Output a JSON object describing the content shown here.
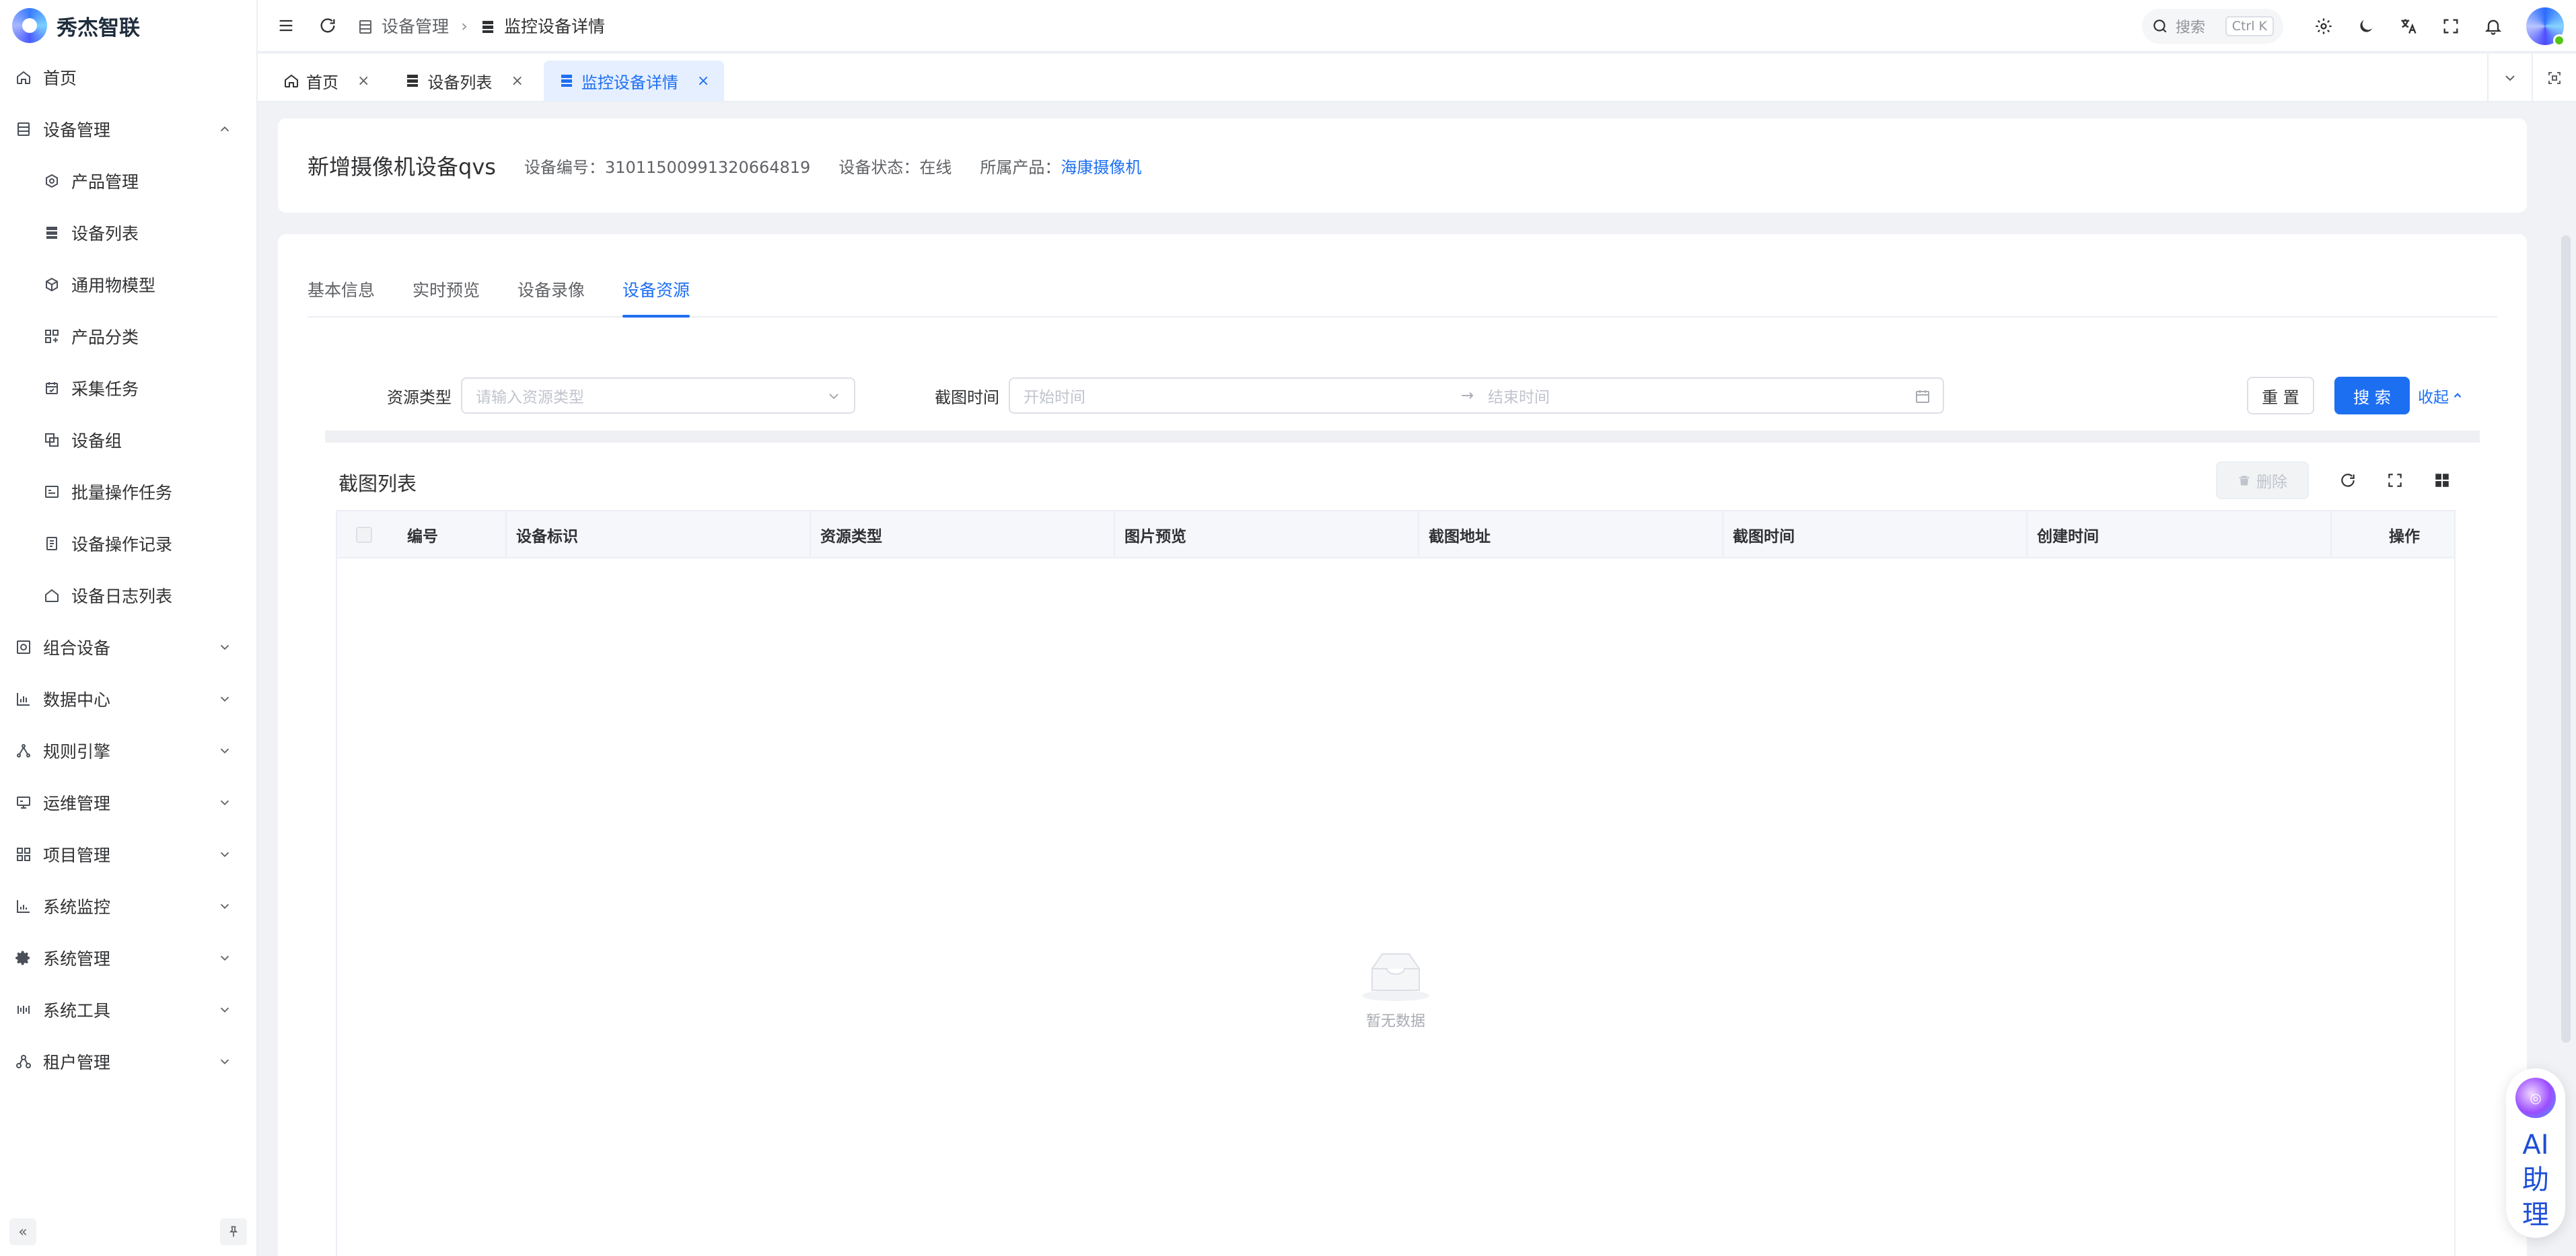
{
  "app": {
    "name": "秀杰智联"
  },
  "sidebar": {
    "items": [
      {
        "label": "首页",
        "icon": "home-icon",
        "sub": false
      },
      {
        "label": "设备管理",
        "icon": "device-icon",
        "sub": false,
        "expanded": true
      },
      {
        "label": "产品管理",
        "icon": "product-icon",
        "sub": true
      },
      {
        "label": "设备列表",
        "icon": "list-icon",
        "sub": true
      },
      {
        "label": "通用物模型",
        "icon": "model-icon",
        "sub": true
      },
      {
        "label": "产品分类",
        "icon": "category-icon",
        "sub": true
      },
      {
        "label": "采集任务",
        "icon": "task-icon",
        "sub": true
      },
      {
        "label": "设备组",
        "icon": "group-icon",
        "sub": true
      },
      {
        "label": "批量操作任务",
        "icon": "batch-icon",
        "sub": true
      },
      {
        "label": "设备操作记录",
        "icon": "record-icon",
        "sub": true
      },
      {
        "label": "设备日志列表",
        "icon": "log-icon",
        "sub": true
      },
      {
        "label": "组合设备",
        "icon": "combo-icon",
        "sub": false,
        "expanded": false
      },
      {
        "label": "数据中心",
        "icon": "chart-icon",
        "sub": false,
        "expanded": false
      },
      {
        "label": "规则引擎",
        "icon": "rule-icon",
        "sub": false,
        "expanded": false
      },
      {
        "label": "运维管理",
        "icon": "ops-icon",
        "sub": false,
        "expanded": false
      },
      {
        "label": "项目管理",
        "icon": "project-icon",
        "sub": false,
        "expanded": false
      },
      {
        "label": "系统监控",
        "icon": "monitor-icon",
        "sub": false,
        "expanded": false
      },
      {
        "label": "系统管理",
        "icon": "gear-icon",
        "sub": false,
        "expanded": false
      },
      {
        "label": "系统工具",
        "icon": "tool-icon",
        "sub": false,
        "expanded": false
      },
      {
        "label": "租户管理",
        "icon": "tenant-icon",
        "sub": false,
        "expanded": false
      }
    ]
  },
  "header": {
    "breadcrumb": [
      "设备管理",
      "监控设备详情"
    ],
    "search": {
      "label": "搜索",
      "shortcut": "Ctrl K"
    }
  },
  "tabs": [
    {
      "label": "首页",
      "active": false
    },
    {
      "label": "设备列表",
      "active": false
    },
    {
      "label": "监控设备详情",
      "active": true
    }
  ],
  "device": {
    "name": "新增摄像机设备qvs",
    "serial_label": "设备编号：",
    "serial": "31011500991320664819",
    "status_label": "设备状态：",
    "status": "在线",
    "product_label": "所属产品：",
    "product": "海康摄像机"
  },
  "detail_tabs": [
    {
      "label": "基本信息",
      "active": false
    },
    {
      "label": "实时预览",
      "active": false
    },
    {
      "label": "设备录像",
      "active": false
    },
    {
      "label": "设备资源",
      "active": true
    }
  ],
  "filters": {
    "resource_type_label": "资源类型",
    "resource_type_placeholder": "请输入资源类型",
    "time_label": "截图时间",
    "start_placeholder": "开始时间",
    "range_separator": "→",
    "end_placeholder": "结束时间",
    "reset": "重 置",
    "search": "搜 索",
    "collapse": "收起"
  },
  "table": {
    "title": "截图列表",
    "delete": "删除",
    "columns": [
      "编号",
      "设备标识",
      "资源类型",
      "图片预览",
      "截图地址",
      "截图时间",
      "创建时间",
      "操作"
    ],
    "rows": [],
    "empty_text": "暂无数据"
  },
  "ai": {
    "label": "AI助理"
  },
  "colors": {
    "primary": "#1d6ff2",
    "border": "#ebeef5",
    "background": "#f0f2f5"
  }
}
